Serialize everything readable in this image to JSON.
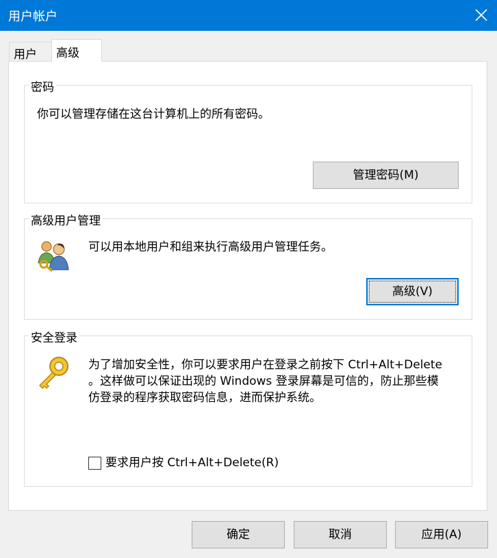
{
  "window": {
    "title": "用户帐户"
  },
  "tabs": [
    {
      "label": "用户",
      "active": false
    },
    {
      "label": "高级",
      "active": true
    }
  ],
  "password_group": {
    "title": "密码",
    "description": "你可以管理存储在这台计算机上的所有密码。",
    "button_label": "管理密码(M)"
  },
  "advanced_group": {
    "title": "高级用户管理",
    "description": "可以用本地用户和组来执行高级用户管理任务。",
    "button_label": "高级(V)",
    "icon": "users-key-icon"
  },
  "secure_logon_group": {
    "title": "安全登录",
    "description_line1": "为了增加安全性，你可以要求用户在登录之前按下 Ctrl+Alt+Delete",
    "description_line2": "。这样做可以保证出现的 Windows 登录屏幕是可信的，防止那些模",
    "description_line3": "仿登录的程序获取密码信息，进而保护系统。",
    "checkbox_label": "要求用户按 Ctrl+Alt+Delete(R)",
    "checkbox_checked": false,
    "icon": "key-icon"
  },
  "footer": {
    "ok_label": "确定",
    "cancel_label": "取消",
    "apply_label": "应用(A)"
  },
  "colors": {
    "titlebar": "#0078d7",
    "focus": "#0078d7"
  }
}
